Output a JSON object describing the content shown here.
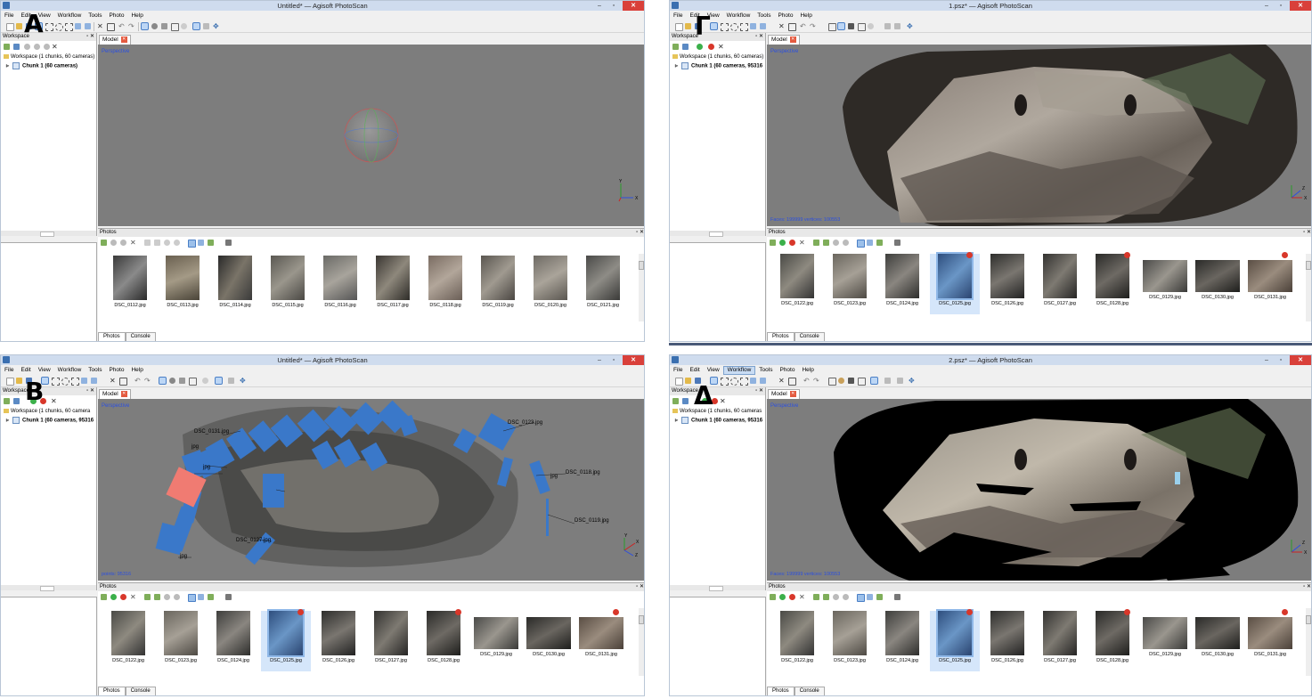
{
  "labels": {
    "A": "A",
    "B": "B",
    "C": "Γ",
    "D": "Δ"
  },
  "menu": [
    "File",
    "Edit",
    "View",
    "Workflow",
    "Tools",
    "Photo",
    "Help"
  ],
  "common": {
    "minimize": "‒",
    "maximize": "▫",
    "close": "✕",
    "workspace_panel": "Workspace",
    "photos_panel": "Photos",
    "model_tab": "Model",
    "perspective": "Perspective",
    "tab_photos": "Photos",
    "tab_console": "Console",
    "panel_controls": "▫ ✕"
  },
  "windows": [
    {
      "title": "Untitled* — Agisoft PhotoScan",
      "workspace_line": "Workspace (1 chunks, 60 cameras)",
      "chunk_line": "Chunk 1 (60 cameras)",
      "viewport_info": "",
      "active_menu": "",
      "photos": [
        "DSC_0112.jpg",
        "DSC_0113.jpg",
        "DSC_0114.jpg",
        "DSC_0115.jpg",
        "DSC_0116.jpg",
        "DSC_0117.jpg",
        "DSC_0118.jpg",
        "DSC_0119.jpg",
        "DSC_0120.jpg",
        "DSC_0121.jpg"
      ]
    },
    {
      "title": "1.psz* — Agisoft PhotoScan",
      "workspace_line": "Workspace (1 chunks, 60 cameras)",
      "chunk_line": "Chunk 1 (60 cameras, 95316",
      "viewport_info": "Faces: 199999 vertices: 100553",
      "active_menu": "",
      "photos": [
        "DSC_0122.jpg",
        "DSC_0123.jpg",
        "DSC_0124.jpg",
        "DSC_0125.jpg",
        "DSC_0126.jpg",
        "DSC_0127.jpg",
        "DSC_0128.jpg",
        "DSC_0129.jpg",
        "DSC_0130.jpg",
        "DSC_0131.jpg"
      ]
    },
    {
      "title": "Untitled* — Agisoft PhotoScan",
      "workspace_line": "Workspace (1 chunks, 60 camera",
      "chunk_line": "Chunk 1 (60 cameras, 95316",
      "viewport_info": "points: 95316",
      "active_menu": "",
      "photos": [
        "DSC_0122.jpg",
        "DSC_0123.jpg",
        "DSC_0124.jpg",
        "DSC_0125.jpg",
        "DSC_0126.jpg",
        "DSC_0127.jpg",
        "DSC_0128.jpg",
        "DSC_0129.jpg",
        "DSC_0130.jpg",
        "DSC_0131.jpg"
      ],
      "camera_labels": [
        "DSC_0123.jpg",
        "DSC_0118.jpg",
        "DSC_0119.jpg",
        "DSC_0127.jpg",
        "DSC_0131.jpg",
        "jpg",
        "jpg",
        "jpg",
        "jpg"
      ]
    },
    {
      "title": "2.psz* — Agisoft PhotoScan",
      "workspace_line": "Workspace (1 chunks, 60 cameras",
      "chunk_line": "Chunk 1 (60 cameras, 95316",
      "viewport_info": "Faces: 199999 vertices: 100553",
      "active_menu": "Workflow",
      "photos": [
        "DSC_0122.jpg",
        "DSC_0123.jpg",
        "DSC_0124.jpg",
        "DSC_0125.jpg",
        "DSC_0126.jpg",
        "DSC_0127.jpg",
        "DSC_0128.jpg",
        "DSC_0129.jpg",
        "DSC_0130.jpg",
        "DSC_0131.jpg"
      ]
    }
  ],
  "colors": {
    "titlebar": "#cfdcee",
    "viewport": "#7d7d7d",
    "camera_blue": "#3a78c9",
    "camera_selected": "#f07b72",
    "info_text": "#2b4fe0"
  }
}
